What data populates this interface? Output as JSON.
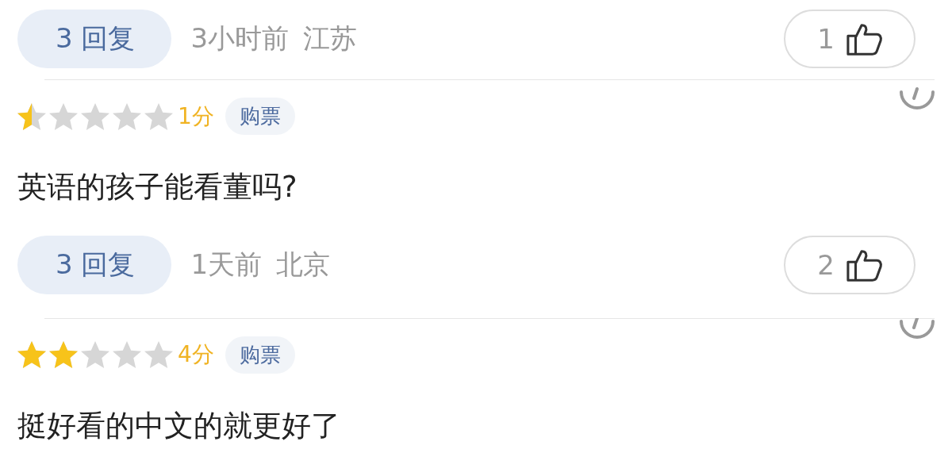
{
  "reviews": [
    {
      "replies": "3 回复",
      "time": "3小时前",
      "location": "江苏",
      "likes": "1"
    },
    {
      "stars": 0.5,
      "score": "1分",
      "tag": "购票",
      "text": "英语的孩子能看董吗?",
      "replies": "3 回复",
      "time": "1天前",
      "location": "北京",
      "likes": "2"
    },
    {
      "stars": 2,
      "score": "4分",
      "tag": "购票",
      "text": "挺好看的中文的就更好了"
    }
  ]
}
